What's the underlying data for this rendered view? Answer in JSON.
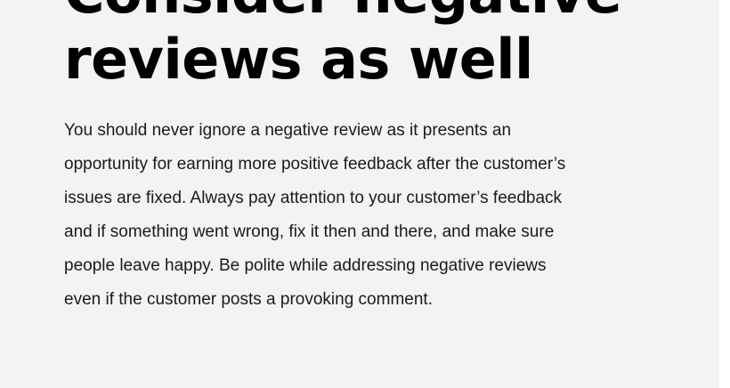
{
  "article": {
    "heading_lines": [
      "Consider negative",
      "reviews as well"
    ],
    "body_lines": [
      "You should never ignore a negative review as it presents an",
      "opportunity for earning more positive feedback after the customer’s",
      "issues are fixed. Always pay attention to your customer’s feedback",
      "and if something went wrong, fix it then and there, and make sure",
      "people leave happy. Be polite while addressing negative reviews",
      "even if the customer posts a provoking comment."
    ]
  },
  "colors": {
    "background": "#f3f3f3",
    "heading": "#000000",
    "body_text": "#1a1a1a"
  }
}
